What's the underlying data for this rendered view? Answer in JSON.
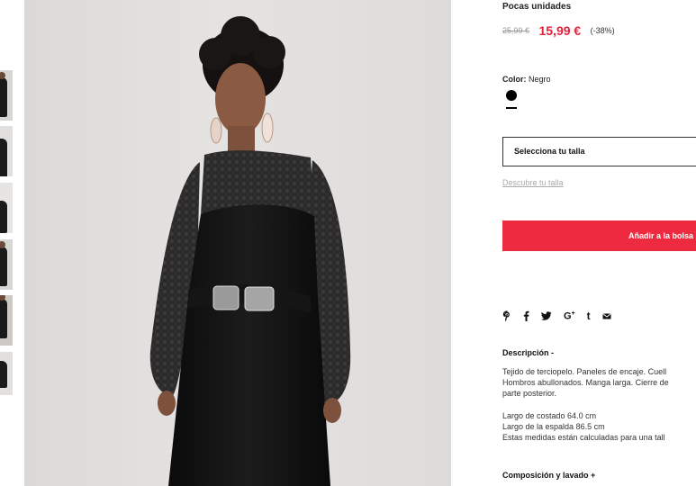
{
  "product": {
    "stock_label": "Pocas unidades",
    "old_price": "25,99 €",
    "price": "15,99 €",
    "discount": "(-38%)",
    "color_label": "Color:",
    "color_value": "Negro",
    "size_select": "Selecciona tu talla",
    "size_guide": "Descubre tu talla",
    "add_to_bag": "Añadir a la bolsa"
  },
  "social": {
    "pinterest": "pinterest-icon",
    "facebook": "facebook-icon",
    "twitter": "twitter-icon",
    "google_plus": "google-plus-icon",
    "tumblr": "tumblr-icon",
    "email": "email-icon"
  },
  "description": {
    "title": "Descripción -",
    "line1": "Tejido de terciopelo. Paneles de encaje. Cuell",
    "line2": "Hombros abullonados. Manga larga. Cierre de",
    "line3": "parte posterior.",
    "line4": "Largo de costado 64.0 cm",
    "line5": "Largo de la espalda 86.5 cm",
    "line6": "Estas medidas están calculadas para una tall"
  },
  "composition": {
    "title": "Composición y lavado +"
  },
  "colors": {
    "accent": "#ee2a40",
    "price": "#e8203a",
    "swatch": "#000000"
  }
}
